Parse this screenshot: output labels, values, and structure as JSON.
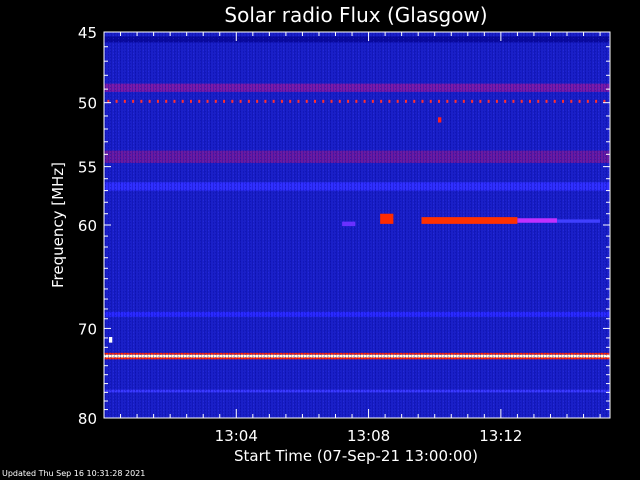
{
  "chart_data": {
    "type": "heatmap",
    "title": "Solar radio Flux (Glasgow)",
    "xlabel": "Start Time (07-Sep-21 13:00:00)",
    "ylabel": "Frequency [MHz]",
    "x_unit": "minutes after 13:00:00",
    "xlim": [
      0,
      15.3
    ],
    "ylim": [
      45,
      80
    ],
    "y_scale": "log (plotted downward)",
    "x_ticks": [
      {
        "value": 4,
        "label": "13:04"
      },
      {
        "value": 8,
        "label": "13:08"
      },
      {
        "value": 12,
        "label": "13:12"
      }
    ],
    "y_ticks": [
      {
        "value": 45,
        "label": "45"
      },
      {
        "value": 50,
        "label": "50"
      },
      {
        "value": 55,
        "label": "55"
      },
      {
        "value": 60,
        "label": "60"
      },
      {
        "value": 70,
        "label": "70"
      },
      {
        "value": 80,
        "label": "80"
      }
    ],
    "colorscale": [
      "#000066",
      "#0000ff",
      "#ff0000",
      "#ffff00",
      "#ffffff"
    ],
    "background_level": "#1a20c8",
    "bands": [
      {
        "freq_low": 45.3,
        "freq_high": 45.7,
        "intensity": "high",
        "color": "#0a0a9e"
      },
      {
        "freq_low": 48.6,
        "freq_high": 49.2,
        "intensity": "high",
        "color": "#7a1aa8"
      },
      {
        "freq_low": 53.7,
        "freq_high": 54.7,
        "intensity": "high",
        "color": "#6a1aa0"
      },
      {
        "freq_low": 56.3,
        "freq_high": 57.0,
        "intensity": "medium",
        "color": "#3030ff"
      },
      {
        "freq_low": 68.3,
        "freq_high": 68.8,
        "intensity": "medium",
        "color": "#2a2aff"
      },
      {
        "freq_low": 72.6,
        "freq_high": 72.8,
        "intensity": "high",
        "color": "#ff2000"
      },
      {
        "freq_low": 72.8,
        "freq_high": 73.1,
        "intensity": "saturated",
        "color": "#ffffe0"
      },
      {
        "freq_low": 73.1,
        "freq_high": 73.3,
        "intensity": "high",
        "color": "#ff2000"
      },
      {
        "freq_low": 76.7,
        "freq_high": 77.0,
        "intensity": "medium",
        "color": "#3a3aff"
      }
    ],
    "dotted_band": {
      "freq": 49.9,
      "color": "#ff3030"
    },
    "bursts": [
      {
        "t_start": 7.2,
        "t_end": 7.6,
        "freq_low": 59.7,
        "freq_high": 60.1,
        "color": "#6a30ff"
      },
      {
        "t_start": 8.35,
        "t_end": 8.75,
        "freq_low": 59.0,
        "freq_high": 59.9,
        "color": "#ff2a00"
      },
      {
        "t_start": 9.6,
        "t_end": 12.5,
        "freq_low": 59.3,
        "freq_high": 59.9,
        "color": "#ff3000"
      },
      {
        "t_start": 12.5,
        "t_end": 13.7,
        "freq_low": 59.4,
        "freq_high": 59.8,
        "color": "#c030ff"
      },
      {
        "t_start": 13.7,
        "t_end": 15.0,
        "freq_low": 59.5,
        "freq_high": 59.8,
        "color": "#4040ff"
      },
      {
        "t_start": 10.1,
        "t_end": 10.2,
        "freq_low": 51.1,
        "freq_high": 51.5,
        "color": "#ff2020"
      },
      {
        "t_start": 0.15,
        "t_end": 0.25,
        "freq_low": 70.9,
        "freq_high": 71.5,
        "color": "#ffffff"
      }
    ]
  },
  "footer": {
    "updated": "Updated Thu Sep 16 10:31:28 2021"
  }
}
